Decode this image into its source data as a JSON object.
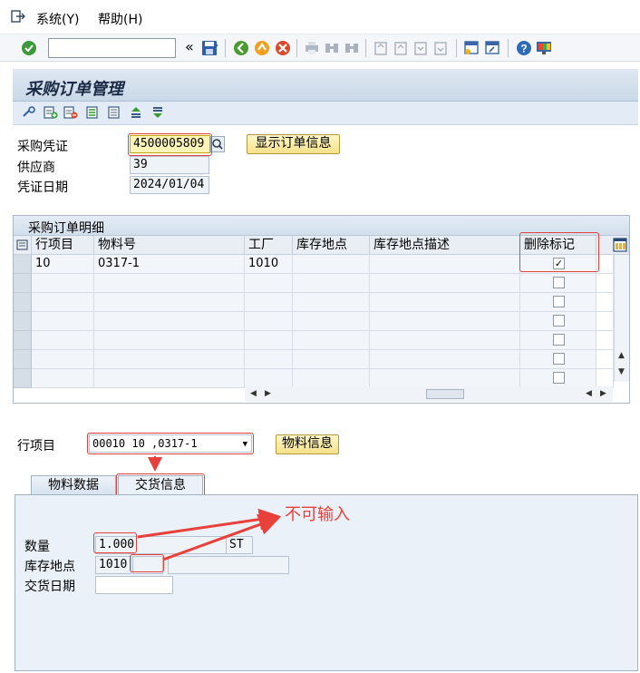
{
  "menu": {
    "items": [
      {
        "label": "系统(Y)"
      },
      {
        "label": "帮助(H)"
      }
    ]
  },
  "toolbar": {
    "command_value": "",
    "nav_back": "«"
  },
  "page": {
    "title": "采购订单管理"
  },
  "header_fields": {
    "po_label": "采购凭证",
    "po_value": "4500005809",
    "vendor_label": "供应商",
    "vendor_value": "39",
    "date_label": "凭证日期",
    "date_value": "2024/01/04",
    "show_button": "显示订单信息"
  },
  "table": {
    "title": "采购订单明细",
    "columns": [
      "行项目",
      "物料号",
      "工厂",
      "库存地点",
      "库存地点描述",
      "删除标记"
    ],
    "rows": [
      {
        "item": "10",
        "material": "0317-1",
        "plant": "1010",
        "storage": "",
        "storage_desc": "",
        "deleted": true
      },
      {
        "item": "",
        "material": "",
        "plant": "",
        "storage": "",
        "storage_desc": "",
        "deleted": false
      },
      {
        "item": "",
        "material": "",
        "plant": "",
        "storage": "",
        "storage_desc": "",
        "deleted": false
      },
      {
        "item": "",
        "material": "",
        "plant": "",
        "storage": "",
        "storage_desc": "",
        "deleted": false
      },
      {
        "item": "",
        "material": "",
        "plant": "",
        "storage": "",
        "storage_desc": "",
        "deleted": false
      },
      {
        "item": "",
        "material": "",
        "plant": "",
        "storage": "",
        "storage_desc": "",
        "deleted": false
      },
      {
        "item": "",
        "material": "",
        "plant": "",
        "storage": "",
        "storage_desc": "",
        "deleted": false
      }
    ],
    "checkmark": "✓"
  },
  "item_select": {
    "label": "行项目",
    "value": "00010 10  ,0317-1",
    "material_button": "物料信息"
  },
  "tabs": [
    {
      "label": "物料数据",
      "active": false
    },
    {
      "label": "交货信息",
      "active": true
    }
  ],
  "delivery": {
    "qty_label": "数量",
    "qty_value": "1.000",
    "unit_value": "ST",
    "storage_label": "库存地点",
    "storage_plant": "1010",
    "storage_value": "",
    "storage_desc": "",
    "date_label": "交货日期",
    "date_value": ""
  },
  "annotation": {
    "text": "不可输入",
    "color": "#e8403a"
  }
}
